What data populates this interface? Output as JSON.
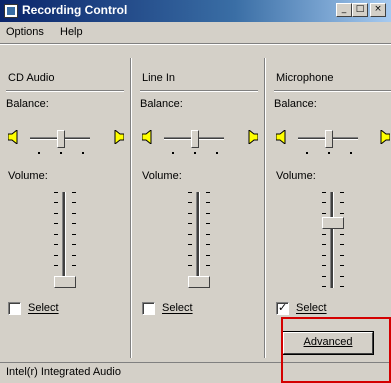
{
  "window": {
    "title": "Recording Control",
    "buttons": [
      "_",
      "□",
      "×"
    ]
  },
  "menu": {
    "items": [
      "Options",
      "Help"
    ]
  },
  "channels": [
    {
      "name": "CD Audio",
      "balance_label": "Balance:",
      "volume_label": "Volume:",
      "select_label": "Select",
      "selected": false,
      "volume_level": 0.0
    },
    {
      "name": "Line In",
      "balance_label": "Balance:",
      "volume_label": "Volume:",
      "select_label": "Select",
      "selected": false,
      "volume_level": 0.0
    },
    {
      "name": "Microphone",
      "balance_label": "Balance:",
      "volume_label": "Volume:",
      "select_label": "Select",
      "selected": true,
      "volume_level": 0.7
    }
  ],
  "advanced_button": {
    "label": "Advanced"
  },
  "status": {
    "text": "Intel(r) Integrated Audio"
  },
  "colors": {
    "highlight_box": "#d40000",
    "title_bar": "#0a246a"
  }
}
